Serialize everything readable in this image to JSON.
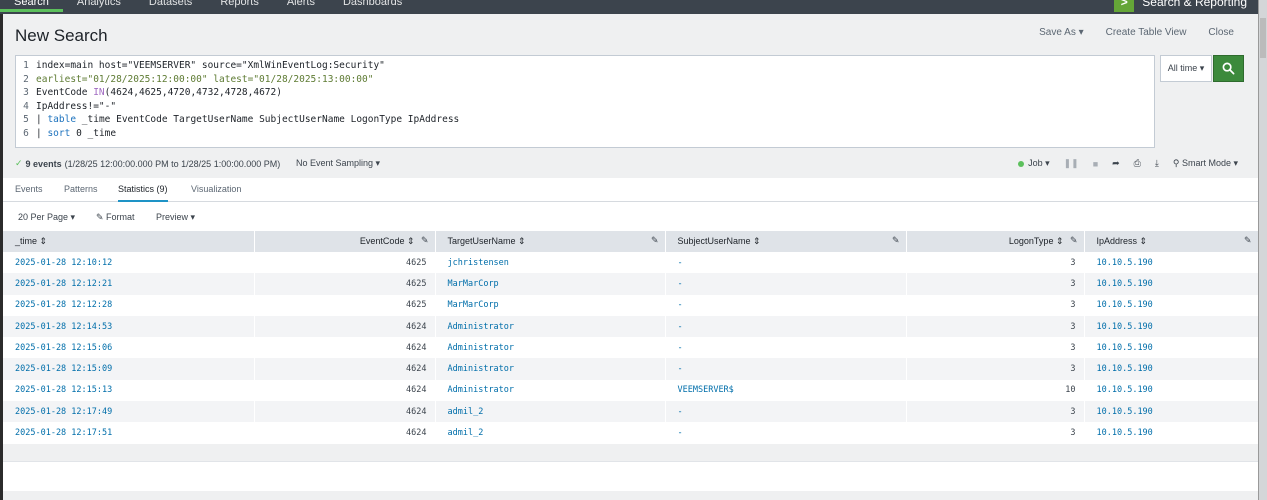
{
  "top_nav": {
    "items": [
      "Search",
      "Analytics",
      "Datasets",
      "Reports",
      "Alerts",
      "Dashboards"
    ],
    "active": "Search",
    "app_name": "Search & Reporting"
  },
  "header": {
    "title": "New Search",
    "save_as": "Save As ▾",
    "create_table_view": "Create Table View",
    "close": "Close"
  },
  "search": {
    "lines": [
      "index=main host=\"VEEMSERVER\" source=\"XmlWinEventLog:Security\"",
      "earliest=\"01/28/2025:12:00:00\" latest=\"01/28/2025:13:00:00\"",
      "EventCode IN(4624,4625,4720,4732,4728,4672)",
      "IpAddress!=\"-\"",
      "| table _time EventCode TargetUserName SubjectUserName LogonType IpAddress",
      "| sort 0 _time"
    ],
    "line_numbers": [
      "1",
      "2",
      "3",
      "4",
      "5",
      "6"
    ],
    "time_range": "All time ▾",
    "search_button_icon": "search-icon"
  },
  "status": {
    "count": "9 events",
    "range": "(1/28/25 12:00:00.000 PM to 1/28/25 1:00:00.000 PM)",
    "sampling": "No Event Sampling ▾",
    "job": "Job ▾",
    "mode": "Smart Mode ▾"
  },
  "tabs": {
    "events": "Events",
    "patterns": "Patterns",
    "statistics": "Statistics (9)",
    "visualization": "Visualization"
  },
  "controls": {
    "per_page": "20 Per Page ▾",
    "format": "Format",
    "preview": "Preview ▾"
  },
  "table": {
    "columns": [
      "_time ⇕",
      "EventCode ⇕",
      "TargetUserName ⇕",
      "SubjectUserName ⇕",
      "LogonType ⇕",
      "IpAddress ⇕"
    ],
    "rows": [
      [
        "2025-01-28 12:10:12",
        "4625",
        "jchristensen",
        "-",
        "3",
        "10.10.5.190"
      ],
      [
        "2025-01-28 12:12:21",
        "4625",
        "MarMarCorp",
        "-",
        "3",
        "10.10.5.190"
      ],
      [
        "2025-01-28 12:12:28",
        "4625",
        "MarMarCorp",
        "-",
        "3",
        "10.10.5.190"
      ],
      [
        "2025-01-28 12:14:53",
        "4624",
        "Administrator",
        "-",
        "3",
        "10.10.5.190"
      ],
      [
        "2025-01-28 12:15:06",
        "4624",
        "Administrator",
        "-",
        "3",
        "10.10.5.190"
      ],
      [
        "2025-01-28 12:15:09",
        "4624",
        "Administrator",
        "-",
        "3",
        "10.10.5.190"
      ],
      [
        "2025-01-28 12:15:13",
        "4624",
        "Administrator",
        "VEEMSERVER$",
        "10",
        "10.10.5.190"
      ],
      [
        "2025-01-28 12:17:49",
        "4624",
        "admil_2",
        "-",
        "3",
        "10.10.5.190"
      ],
      [
        "2025-01-28 12:17:51",
        "4624",
        "admil_2",
        "-",
        "3",
        "10.10.5.190"
      ]
    ]
  },
  "colors": {
    "accent_green": "#5cc05c",
    "link_blue": "#006eaa",
    "nav_bg": "#3c444d",
    "search_button": "#3c8a3c"
  }
}
